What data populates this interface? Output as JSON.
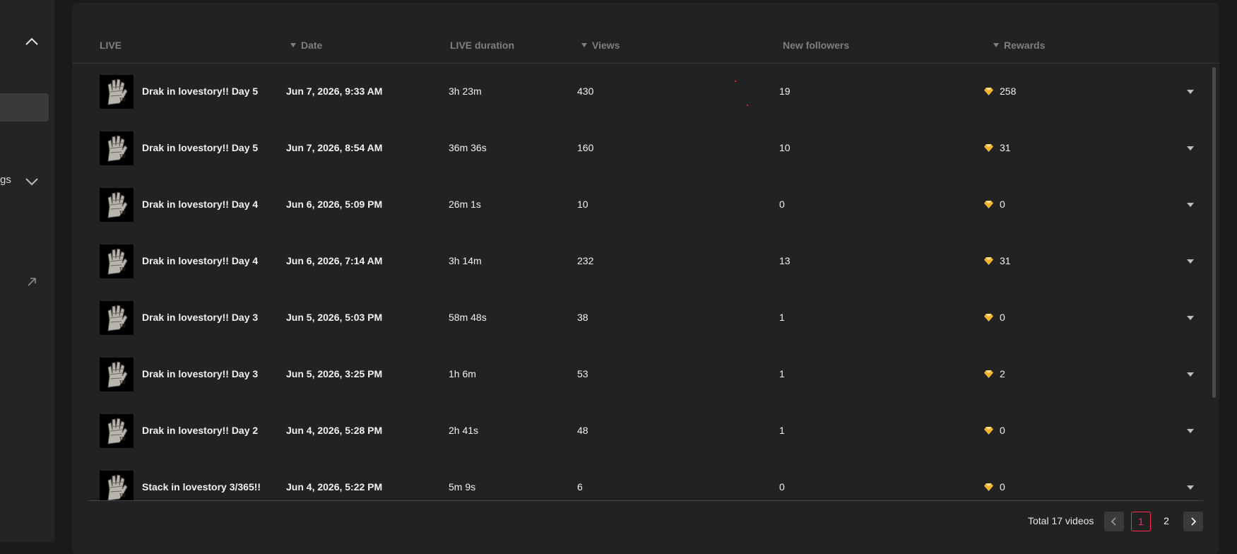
{
  "sidebar": {
    "partial_label": "gs"
  },
  "table": {
    "headers": {
      "live": "LIVE",
      "date": "Date",
      "duration": "LIVE duration",
      "views": "Views",
      "followers": "New followers",
      "rewards": "Rewards"
    },
    "rows": [
      {
        "title": "Drak in lovestory!! Day 5",
        "date": "Jun 7, 2026, 9:33 AM",
        "duration": "3h 23m",
        "views": "430",
        "followers": "19",
        "rewards": "258"
      },
      {
        "title": "Drak in lovestory!! Day 5",
        "date": "Jun 7, 2026, 8:54 AM",
        "duration": "36m 36s",
        "views": "160",
        "followers": "10",
        "rewards": "31"
      },
      {
        "title": "Drak in lovestory!! Day 4",
        "date": "Jun 6, 2026, 5:09 PM",
        "duration": "26m 1s",
        "views": "10",
        "followers": "0",
        "rewards": "0"
      },
      {
        "title": "Drak in lovestory!! Day 4",
        "date": "Jun 6, 2026, 7:14 AM",
        "duration": "3h 14m",
        "views": "232",
        "followers": "13",
        "rewards": "31"
      },
      {
        "title": "Drak in lovestory!! Day 3",
        "date": "Jun 5, 2026, 5:03 PM",
        "duration": "58m 48s",
        "views": "38",
        "followers": "1",
        "rewards": "0"
      },
      {
        "title": "Drak in lovestory!! Day 3",
        "date": "Jun 5, 2026, 3:25 PM",
        "duration": "1h 6m",
        "views": "53",
        "followers": "1",
        "rewards": "2"
      },
      {
        "title": "Drak in lovestory!! Day 2",
        "date": "Jun 4, 2026, 5:28 PM",
        "duration": "2h 41s",
        "views": "48",
        "followers": "1",
        "rewards": "0"
      },
      {
        "title": "Stack in lovestory 3/365!!",
        "date": "Jun 4, 2026, 5:22 PM",
        "duration": "5m 9s",
        "views": "6",
        "followers": "0",
        "rewards": "0"
      }
    ]
  },
  "pagination": {
    "total": "Total 17 videos",
    "pages": [
      "1",
      "2"
    ],
    "current": "1"
  },
  "colors": {
    "accent": "#fe2c55",
    "background": "#1a1a1a",
    "panel": "#222222",
    "gem": "#f5b335"
  },
  "icons": {
    "sort": "sort-down-icon",
    "gem": "gem-icon",
    "expand": "caret-down-icon",
    "prev": "chevron-left-icon",
    "next": "chevron-right-icon"
  }
}
